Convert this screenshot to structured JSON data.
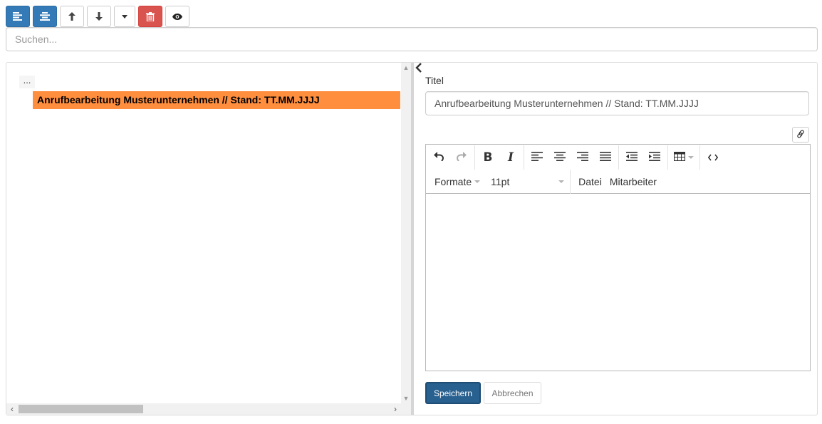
{
  "toolbar": {
    "buttons": [
      {
        "icon": "align-left-icon",
        "style": "primary"
      },
      {
        "icon": "align-center-icon",
        "style": "primary"
      },
      {
        "icon": "arrow-up-icon",
        "style": "default"
      },
      {
        "icon": "arrow-down-icon",
        "style": "default"
      },
      {
        "icon": "caret-down-icon",
        "style": "default"
      },
      {
        "icon": "trash-icon",
        "style": "danger"
      },
      {
        "icon": "eye-icon",
        "style": "default"
      }
    ]
  },
  "search": {
    "placeholder": "Suchen...",
    "value": ""
  },
  "tree": {
    "ellipsis": "...",
    "selected_node": "Anrufbearbeitung Musterunternehmen // Stand: TT.MM.JJJJ"
  },
  "form": {
    "title_label": "Titel",
    "title_value": "Anrufbearbeitung Musterunternehmen // Stand: TT.MM.JJJJ"
  },
  "editor": {
    "formats_label": "Formate",
    "font_size": "11pt",
    "menu_file": "Datei",
    "menu_staff": "Mitarbeiter"
  },
  "actions": {
    "save": "Speichern",
    "cancel": "Abbrechen"
  },
  "colors": {
    "primary": "#337ab7",
    "danger": "#d9534f",
    "selected_node": "#ff8f3f",
    "save_button": "#286090"
  }
}
